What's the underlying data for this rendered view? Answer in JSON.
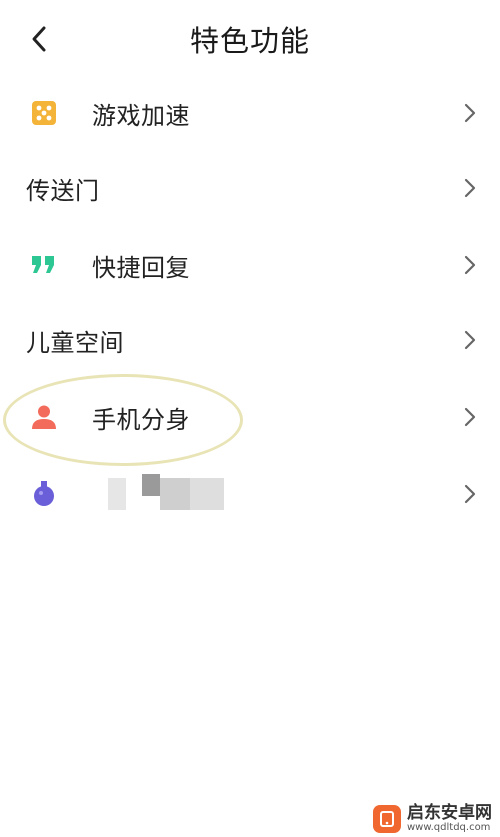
{
  "header": {
    "title": "特色功能",
    "back_icon": "chevron-left-icon"
  },
  "menu": [
    {
      "label": "游戏加速",
      "icon": "game-dice-icon",
      "icon_color": "#f4b43a"
    },
    {
      "label": "传送门"
    },
    {
      "label": "快捷回复",
      "icon": "quote-icon",
      "icon_color": "#2cc793"
    },
    {
      "label": "儿童空间"
    },
    {
      "label": "手机分身",
      "icon": "user-icon",
      "icon_color": "#f26b5b"
    },
    {
      "label": "",
      "icon": "potion-flask-icon",
      "icon_color": "#6a5fd8"
    }
  ],
  "highlight_color": "#e9e4b6",
  "watermark": {
    "name": "启东安卓网",
    "url": "www.qdltdq.com"
  }
}
